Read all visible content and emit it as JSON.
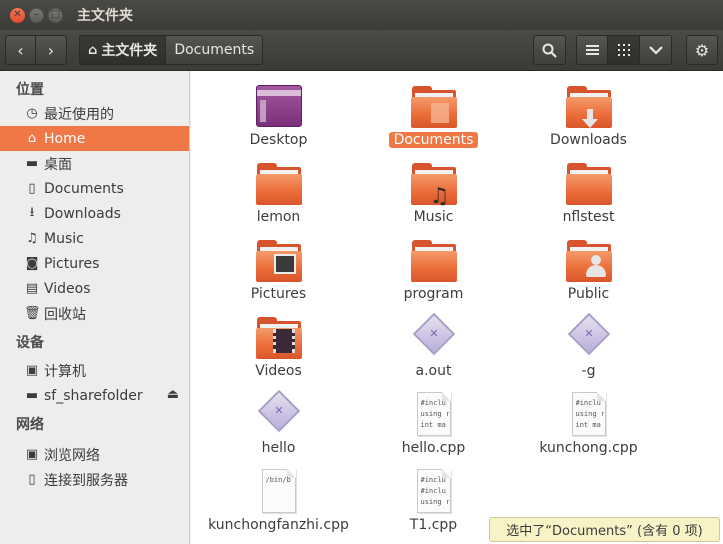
{
  "window": {
    "title": "主文件夹"
  },
  "toolbar": {
    "back_icon": "‹",
    "forward_icon": "›",
    "crumbs": [
      "主文件夹",
      "Documents"
    ],
    "search_icon": "search",
    "view_list_icon": "list",
    "view_grid_icon": "grid",
    "view_options_icon": "chevron-down",
    "settings_icon": "gear"
  },
  "sidebar": {
    "sections": [
      {
        "title": "位置"
      },
      {
        "title": "设备"
      },
      {
        "title": "网络"
      }
    ],
    "places": [
      {
        "label": "最近使用的",
        "icon": "clock"
      },
      {
        "label": "Home",
        "icon": "home",
        "selected": true
      },
      {
        "label": "桌面",
        "icon": "folder"
      },
      {
        "label": "Documents",
        "icon": "document"
      },
      {
        "label": "Downloads",
        "icon": "download"
      },
      {
        "label": "Music",
        "icon": "music"
      },
      {
        "label": "Pictures",
        "icon": "camera"
      },
      {
        "label": "Videos",
        "icon": "film"
      },
      {
        "label": "回收站",
        "icon": "trash"
      }
    ],
    "devices": [
      {
        "label": "计算机",
        "icon": "computer"
      },
      {
        "label": "sf_sharefolder",
        "icon": "drive"
      }
    ],
    "network": [
      {
        "label": "浏览网络",
        "icon": "network"
      },
      {
        "label": "连接到服务器",
        "icon": "server"
      }
    ]
  },
  "files": [
    {
      "name": "Desktop",
      "type": "desktop"
    },
    {
      "name": "Documents",
      "type": "folder-documents",
      "selected": true
    },
    {
      "name": "Downloads",
      "type": "folder-downloads"
    },
    {
      "name": "lemon",
      "type": "folder"
    },
    {
      "name": "Music",
      "type": "folder-music"
    },
    {
      "name": "nflstest",
      "type": "folder"
    },
    {
      "name": "Pictures",
      "type": "folder-pictures"
    },
    {
      "name": "program",
      "type": "folder"
    },
    {
      "name": "Public",
      "type": "folder-public"
    },
    {
      "name": "Videos",
      "type": "folder-videos"
    },
    {
      "name": "a.out",
      "type": "executable"
    },
    {
      "name": "-g",
      "type": "executable"
    },
    {
      "name": "hello",
      "type": "executable"
    },
    {
      "name": "hello.cpp",
      "type": "source",
      "preview": [
        "#inclu",
        "using r",
        "int ma"
      ]
    },
    {
      "name": "kunchong.cpp",
      "type": "source",
      "preview": [
        "#inclu",
        "using r",
        "int ma"
      ]
    },
    {
      "name": "kunchongfanzhi.cpp",
      "type": "script",
      "preview": [
        "/bin/b"
      ]
    },
    {
      "name": "T1.cpp",
      "type": "source",
      "preview": [
        "#inclu",
        "#inclu",
        "using r"
      ]
    }
  ],
  "status": {
    "text": "选中了“Documents” (含有 0 项)"
  },
  "colors": {
    "accent": "#f07746",
    "titlebar": "#3c3b37",
    "folder": "#ec6f3b"
  }
}
